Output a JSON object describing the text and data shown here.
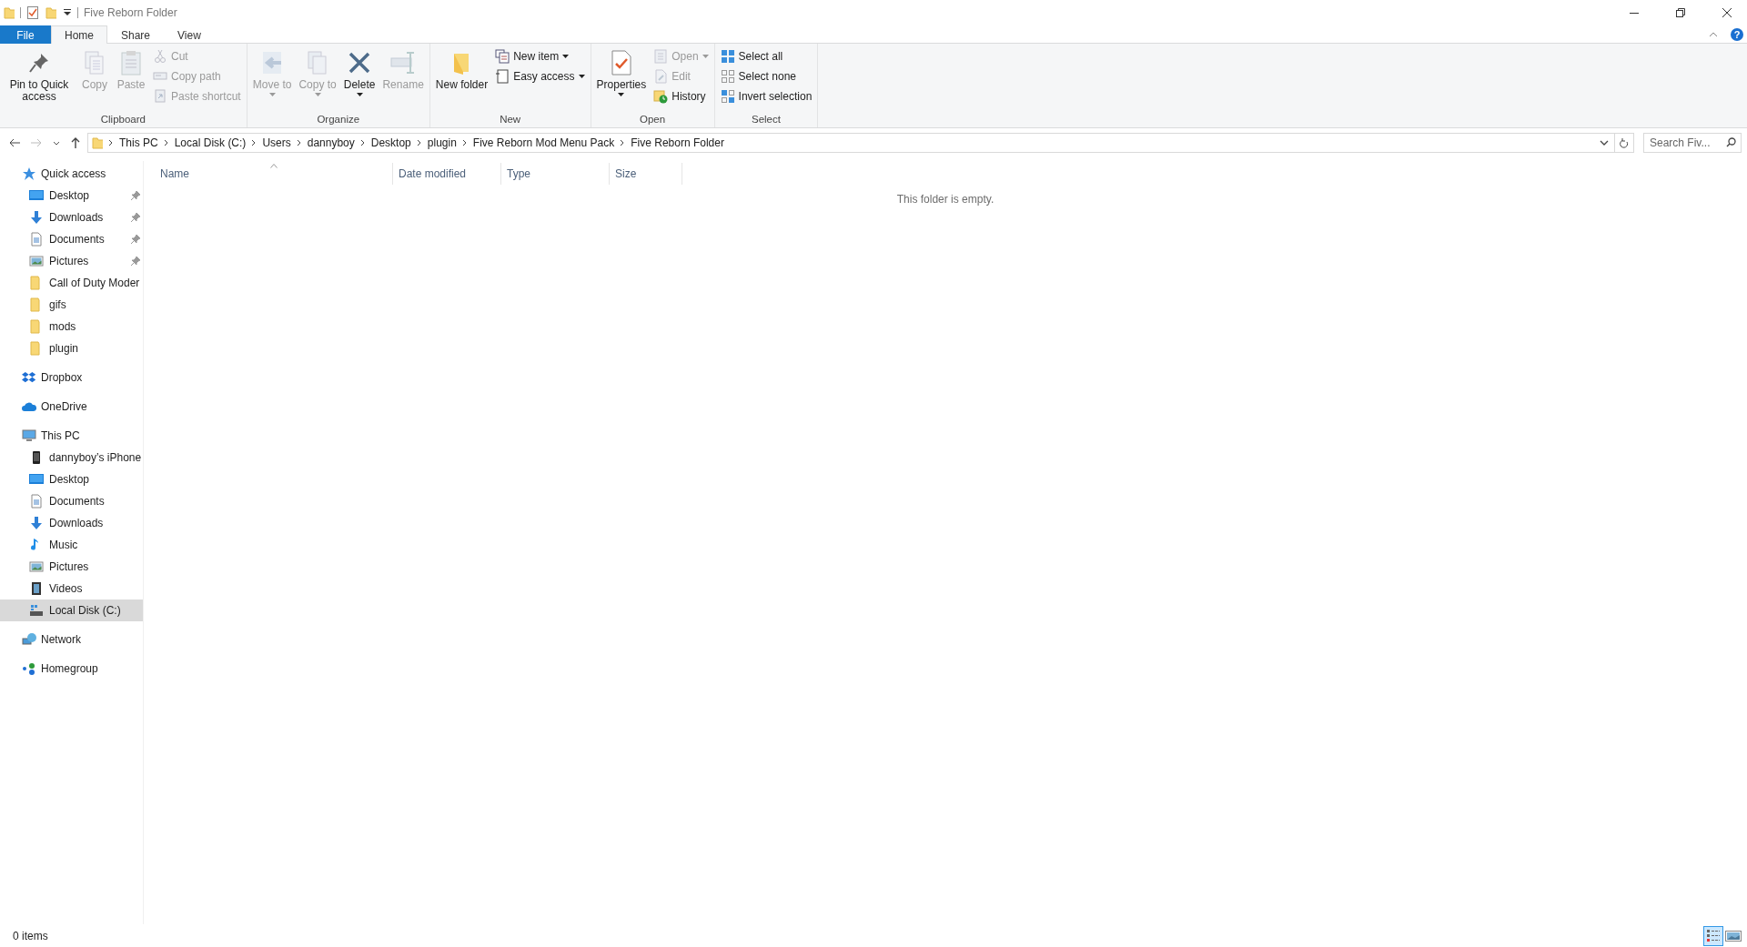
{
  "window": {
    "title": "Five Reborn Folder",
    "help": "?"
  },
  "ribbon_tabs": [
    {
      "label": "File",
      "kind": "file",
      "selected": false
    },
    {
      "label": "Home",
      "kind": "tab",
      "selected": true
    },
    {
      "label": "Share",
      "kind": "tab",
      "selected": false
    },
    {
      "label": "View",
      "kind": "tab",
      "selected": false
    }
  ],
  "ribbon_groups": [
    {
      "label": "Clipboard",
      "commands": [
        {
          "label": "Pin to Quick access",
          "kind": "large",
          "disabled": false,
          "dropdown": false
        },
        {
          "label": "Copy",
          "kind": "large",
          "disabled": true,
          "dropdown": false
        },
        {
          "label": "Paste",
          "kind": "large",
          "disabled": true,
          "dropdown": false
        },
        {
          "label": "Cut",
          "kind": "small",
          "disabled": true,
          "dropdown": false
        },
        {
          "label": "Copy path",
          "kind": "small",
          "disabled": true,
          "dropdown": false
        },
        {
          "label": "Paste shortcut",
          "kind": "small",
          "disabled": true,
          "dropdown": false
        }
      ]
    },
    {
      "label": "Organize",
      "commands": [
        {
          "label": "Move to",
          "kind": "large",
          "disabled": true,
          "dropdown": true
        },
        {
          "label": "Copy to",
          "kind": "large",
          "disabled": true,
          "dropdown": true
        },
        {
          "label": "Delete",
          "kind": "large",
          "disabled": false,
          "dropdown": true
        },
        {
          "label": "Rename",
          "kind": "large",
          "disabled": true,
          "dropdown": false
        }
      ]
    },
    {
      "label": "New",
      "commands": [
        {
          "label": "New folder",
          "kind": "large",
          "disabled": false,
          "dropdown": false
        },
        {
          "label": "New item",
          "kind": "small",
          "disabled": false,
          "dropdown": true
        },
        {
          "label": "Easy access",
          "kind": "small",
          "disabled": false,
          "dropdown": true
        }
      ]
    },
    {
      "label": "Open",
      "commands": [
        {
          "label": "Properties",
          "kind": "large",
          "disabled": false,
          "dropdown": true
        },
        {
          "label": "Open",
          "kind": "small",
          "disabled": true,
          "dropdown": true
        },
        {
          "label": "Edit",
          "kind": "small",
          "disabled": true,
          "dropdown": false
        },
        {
          "label": "History",
          "kind": "small",
          "disabled": false,
          "dropdown": false
        }
      ]
    },
    {
      "label": "Select",
      "commands": [
        {
          "label": "Select all",
          "kind": "small",
          "disabled": false,
          "dropdown": false
        },
        {
          "label": "Select none",
          "kind": "small",
          "disabled": false,
          "dropdown": false
        },
        {
          "label": "Invert selection",
          "kind": "small",
          "disabled": false,
          "dropdown": false
        }
      ]
    }
  ],
  "address_bar": {
    "crumbs": [
      "This PC",
      "Local Disk (C:)",
      "Users",
      "dannyboy",
      "Desktop",
      "plugin",
      "Five Reborn Mod Menu Pack",
      "Five Reborn Folder"
    ]
  },
  "search": {
    "placeholder": "Search Fiv..."
  },
  "navigation": [
    {
      "label": "Quick access",
      "kind": "star",
      "selected": false,
      "children": [
        {
          "label": "Desktop",
          "kind": "desktop",
          "pinned": true,
          "selected": false
        },
        {
          "label": "Downloads",
          "kind": "download",
          "pinned": true,
          "selected": false
        },
        {
          "label": "Documents",
          "kind": "document",
          "pinned": true,
          "selected": false
        },
        {
          "label": "Pictures",
          "kind": "pictures",
          "pinned": true,
          "selected": false
        },
        {
          "label": "Call of Duty Moder",
          "kind": "folder",
          "pinned": false,
          "selected": false
        },
        {
          "label": "gifs",
          "kind": "folder",
          "pinned": false,
          "selected": false
        },
        {
          "label": "mods",
          "kind": "folder",
          "pinned": false,
          "selected": false
        },
        {
          "label": "plugin",
          "kind": "folder",
          "pinned": false,
          "selected": false
        }
      ]
    },
    {
      "label": "Dropbox",
      "kind": "dropbox",
      "selected": false
    },
    {
      "label": "OneDrive",
      "kind": "cloud",
      "selected": false
    },
    {
      "label": "This PC",
      "kind": "pc",
      "selected": false,
      "children": [
        {
          "label": "dannyboy’s iPhone",
          "kind": "phone",
          "pinned": false,
          "selected": false
        },
        {
          "label": "Desktop",
          "kind": "desktop",
          "pinned": false,
          "selected": false
        },
        {
          "label": "Documents",
          "kind": "document",
          "pinned": false,
          "selected": false
        },
        {
          "label": "Downloads",
          "kind": "download",
          "pinned": false,
          "selected": false
        },
        {
          "label": "Music",
          "kind": "music",
          "pinned": false,
          "selected": false
        },
        {
          "label": "Pictures",
          "kind": "pictures",
          "pinned": false,
          "selected": false
        },
        {
          "label": "Videos",
          "kind": "videos",
          "pinned": false,
          "selected": false
        },
        {
          "label": "Local Disk (C:)",
          "kind": "disk",
          "pinned": false,
          "selected": true
        }
      ]
    },
    {
      "label": "Network",
      "kind": "network",
      "selected": false
    },
    {
      "label": "Homegroup",
      "kind": "homegroup",
      "selected": false
    }
  ],
  "file_list": {
    "columns": [
      {
        "label": "Name",
        "sorted": true
      },
      {
        "label": "Date modified",
        "sorted": false
      },
      {
        "label": "Type",
        "sorted": false
      },
      {
        "label": "Size",
        "sorted": false
      }
    ],
    "empty_message": "This folder is empty."
  },
  "status_bar": {
    "item_count": "0 items",
    "views": [
      {
        "kind": "details",
        "selected": true
      },
      {
        "kind": "large-icons",
        "selected": false
      }
    ]
  }
}
